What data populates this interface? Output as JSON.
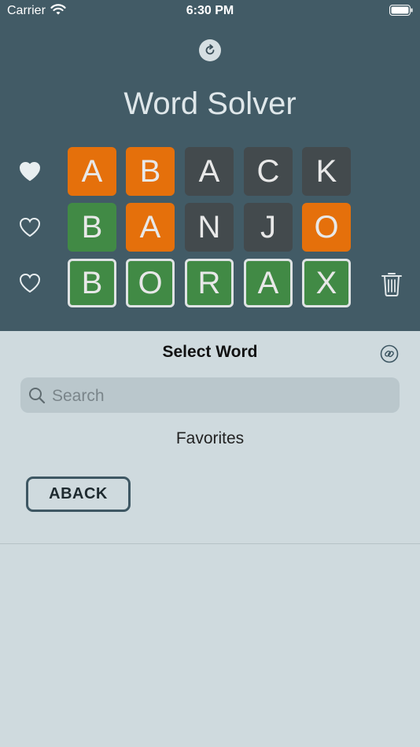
{
  "status_bar": {
    "carrier": "Carrier",
    "time": "6:30 PM"
  },
  "header": {
    "title": "Word Solver",
    "refresh_icon": "refresh-icon"
  },
  "rows": [
    {
      "favorite": true,
      "letters": [
        {
          "char": "A",
          "color": "orange"
        },
        {
          "char": "B",
          "color": "orange"
        },
        {
          "char": "A",
          "color": "gray"
        },
        {
          "char": "C",
          "color": "gray"
        },
        {
          "char": "K",
          "color": "gray"
        }
      ]
    },
    {
      "favorite": false,
      "letters": [
        {
          "char": "B",
          "color": "green"
        },
        {
          "char": "A",
          "color": "orange"
        },
        {
          "char": "N",
          "color": "gray"
        },
        {
          "char": "J",
          "color": "gray"
        },
        {
          "char": "O",
          "color": "orange"
        }
      ]
    },
    {
      "favorite": false,
      "letters": [
        {
          "char": "B",
          "color": "green"
        },
        {
          "char": "O",
          "color": "green"
        },
        {
          "char": "R",
          "color": "green"
        },
        {
          "char": "A",
          "color": "green"
        },
        {
          "char": "X",
          "color": "green"
        }
      ]
    }
  ],
  "colors": {
    "orange": "#e5700b",
    "gray": "#434a4d",
    "green": "#418a45",
    "header_bg": "#425b66",
    "sheet_bg": "#cfdade"
  },
  "sheet": {
    "title": "Select Word",
    "search": {
      "placeholder": "Search",
      "value": ""
    },
    "section_label": "Favorites",
    "favorites": [
      "ABACK"
    ]
  }
}
